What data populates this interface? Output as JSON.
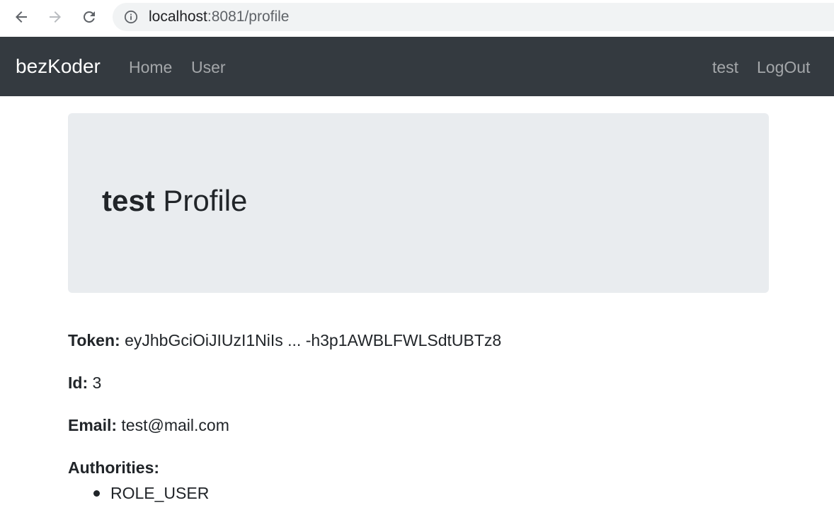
{
  "browser": {
    "url_host": "localhost",
    "url_rest": ":8081/profile"
  },
  "navbar": {
    "brand": "bezKoder",
    "links": [
      {
        "label": "Home"
      },
      {
        "label": "User"
      }
    ],
    "right_links": [
      {
        "label": "test"
      },
      {
        "label": "LogOut"
      }
    ]
  },
  "profile": {
    "username": "test",
    "title_suffix": " Profile",
    "token_label": "Token:",
    "token_value": " eyJhbGciOiJIUzI1NiIs ... -h3p1AWBLFWLSdtUBTz8",
    "id_label": "Id:",
    "id_value": " 3",
    "email_label": "Email:",
    "email_value": " test@mail.com",
    "authorities_label": "Authorities:",
    "authorities": [
      "ROLE_USER"
    ]
  },
  "colors": {
    "navbar_bg": "#343a40",
    "jumbotron_bg": "#e9ecef",
    "text": "#212529"
  }
}
